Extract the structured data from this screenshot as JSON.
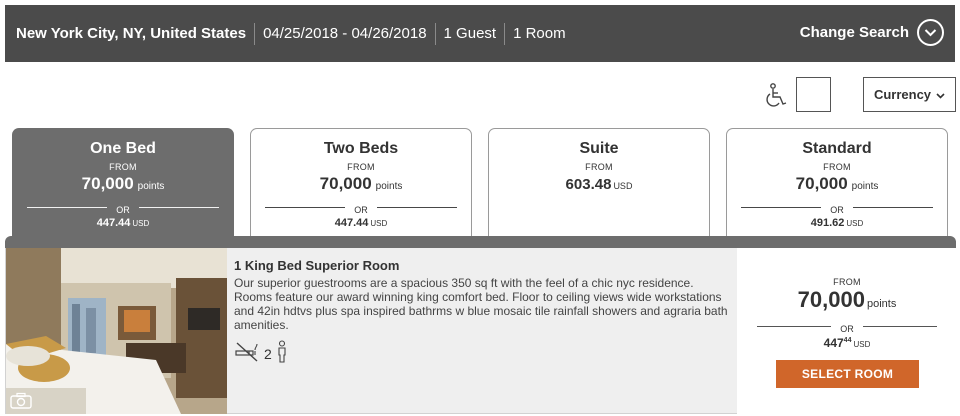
{
  "search": {
    "location": "New York City, NY, United States",
    "dates": "04/25/2018 - 04/26/2018",
    "guests": "1 Guest",
    "rooms": "1 Room",
    "change_label": "Change Search"
  },
  "utility": {
    "currency_label": "Currency"
  },
  "tabs": [
    {
      "name": "One Bed",
      "from": "FROM",
      "points": "70,000",
      "points_unit": "points",
      "or": "OR",
      "usd": "447.44",
      "usd_unit": "USD",
      "active": true
    },
    {
      "name": "Two Beds",
      "from": "FROM",
      "points": "70,000",
      "points_unit": "points",
      "or": "OR",
      "usd": "447.44",
      "usd_unit": "USD",
      "active": false
    },
    {
      "name": "Suite",
      "from": "FROM",
      "usd": "603.48",
      "usd_unit": "USD",
      "active": false
    },
    {
      "name": "Standard",
      "from": "FROM",
      "points": "70,000",
      "points_unit": "points",
      "or": "OR",
      "usd": "491.62",
      "usd_unit": "USD",
      "active": false
    }
  ],
  "room": {
    "title": "1 King Bed Superior Room",
    "description": "Our superior guestrooms are a spacious 350 sq ft with the feel of a chic nyc residence. Rooms feature our award winning king comfort bed. Floor to ceiling views wide workstations and 42in hdtvs plus spa inspired bathrms w blue mosaic tile rainfall showers and agraria bath amenities.",
    "occupancy": "2",
    "icons": [
      "no-smoking-icon",
      "person-icon",
      "camera-icon"
    ],
    "price": {
      "from": "FROM",
      "points": "70,000",
      "points_unit": "points",
      "or": "OR",
      "usd_whole": "447",
      "usd_cents": "44",
      "usd_unit": "USD"
    },
    "select_label": "SELECT ROOM"
  },
  "colors": {
    "topbar": "#4b4b4b",
    "active_tab": "#6d6d6d",
    "select_button": "#d0662a",
    "room_bg": "#efefef"
  }
}
